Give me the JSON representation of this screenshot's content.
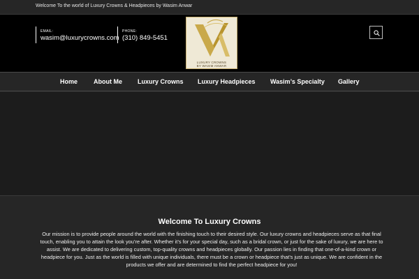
{
  "topbar": {
    "welcome_text": "Welcome To the world of Luxury Crowns & Headpieces by Wasim Anwar"
  },
  "header": {
    "email_label": "EMAIL:",
    "email_value": "wasim@luxurycrowns.com",
    "phone_label": "PHONE:",
    "phone_value": "(310) 849-5451",
    "logo_line1": "LUXURY CROWNS",
    "logo_line2": "BY WASIM ANWAR"
  },
  "nav": {
    "items": [
      {
        "label": "Home"
      },
      {
        "label": "About Me"
      },
      {
        "label": "Luxury Crowns"
      },
      {
        "label": "Luxury Headpieces"
      },
      {
        "label": "Wasim’s Specialty"
      },
      {
        "label": "Gallery"
      }
    ]
  },
  "intro": {
    "title": "Welcome To Luxury Crowns",
    "body": "Our mission is to provide people around the world with the finishing touch to their desired style. Our luxury crowns and headpieces serve as that final touch, enabling you to attain the look you’re after. Whether it’s for your special day, such as a bridal crown, or just for the sake of luxury, we are here to assist. We are dedicated to delivering custom, top-quality crowns and headpieces globally. Our passion lies in finding that one-of-a-kind crown or headpiece for you. Just as the world is filled with unique individuals, there must be a crown or headpiece that’s just as unique. We are confident in the products we offer and are determined to find the perfect headpiece for you!"
  },
  "icons": {
    "search": "search-icon",
    "logo": "crown-logo-icon"
  },
  "colors": {
    "background": "#262626",
    "header": "#000000",
    "gold": "#c9a94a"
  }
}
